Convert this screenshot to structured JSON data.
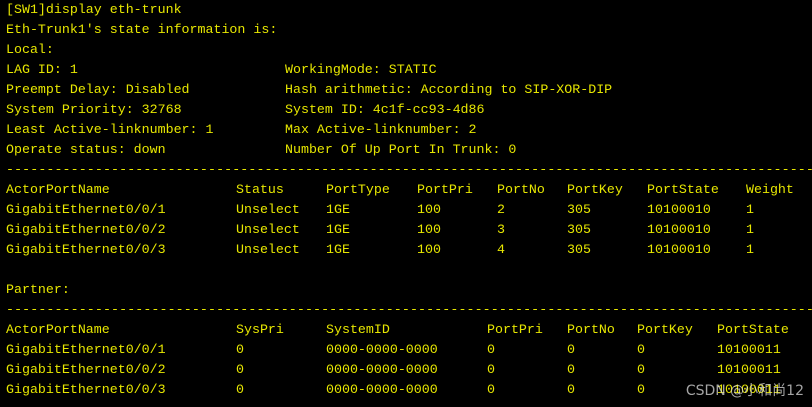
{
  "colors": {
    "background": "#000000",
    "text": "#e7e700",
    "watermark": "#dcdcdc"
  },
  "command": "[SW1]display eth-trunk",
  "state_header": "Eth-Trunk1's state information is:",
  "local": {
    "title": "Local:",
    "lag_id": "LAG ID: 1",
    "working_mode": "WorkingMode: STATIC",
    "preempt_delay": "Preempt Delay: Disabled",
    "hash": "Hash arithmetic: According to SIP-XOR-DIP",
    "system_priority": "System Priority: 32768",
    "system_id": "System ID: 4c1f-cc93-4d86",
    "least_active": "Least Active-linknumber: 1",
    "max_active": "Max Active-linknumber: 2",
    "operate_status": "Operate status: down",
    "up_ports": "Number Of Up Port In Trunk: 0"
  },
  "separator": "--------------------------------------------------------------------------------------------------------",
  "actor_table": {
    "headers": [
      "ActorPortName",
      "Status",
      "PortType",
      "PortPri",
      "PortNo",
      "PortKey",
      "PortState",
      "Weight"
    ],
    "rows": [
      [
        "GigabitEthernet0/0/1",
        "Unselect",
        "1GE",
        "100",
        "2",
        "305",
        "10100010",
        "1"
      ],
      [
        "GigabitEthernet0/0/2",
        "Unselect",
        "1GE",
        "100",
        "3",
        "305",
        "10100010",
        "1"
      ],
      [
        "GigabitEthernet0/0/3",
        "Unselect",
        "1GE",
        "100",
        "4",
        "305",
        "10100010",
        "1"
      ]
    ]
  },
  "partner": {
    "title": "Partner:"
  },
  "partner_table": {
    "headers": [
      "ActorPortName",
      "SysPri",
      "SystemID",
      "PortPri",
      "PortNo",
      "PortKey",
      "PortState"
    ],
    "rows": [
      [
        "GigabitEthernet0/0/1",
        "0",
        "0000-0000-0000",
        "0",
        "0",
        "0",
        "10100011"
      ],
      [
        "GigabitEthernet0/0/2",
        "0",
        "0000-0000-0000",
        "0",
        "0",
        "0",
        "10100011"
      ],
      [
        "GigabitEthernet0/0/3",
        "0",
        "0000-0000-0000",
        "0",
        "0",
        "0",
        "10100011"
      ]
    ]
  },
  "watermark": "CSDN @小和尚12"
}
